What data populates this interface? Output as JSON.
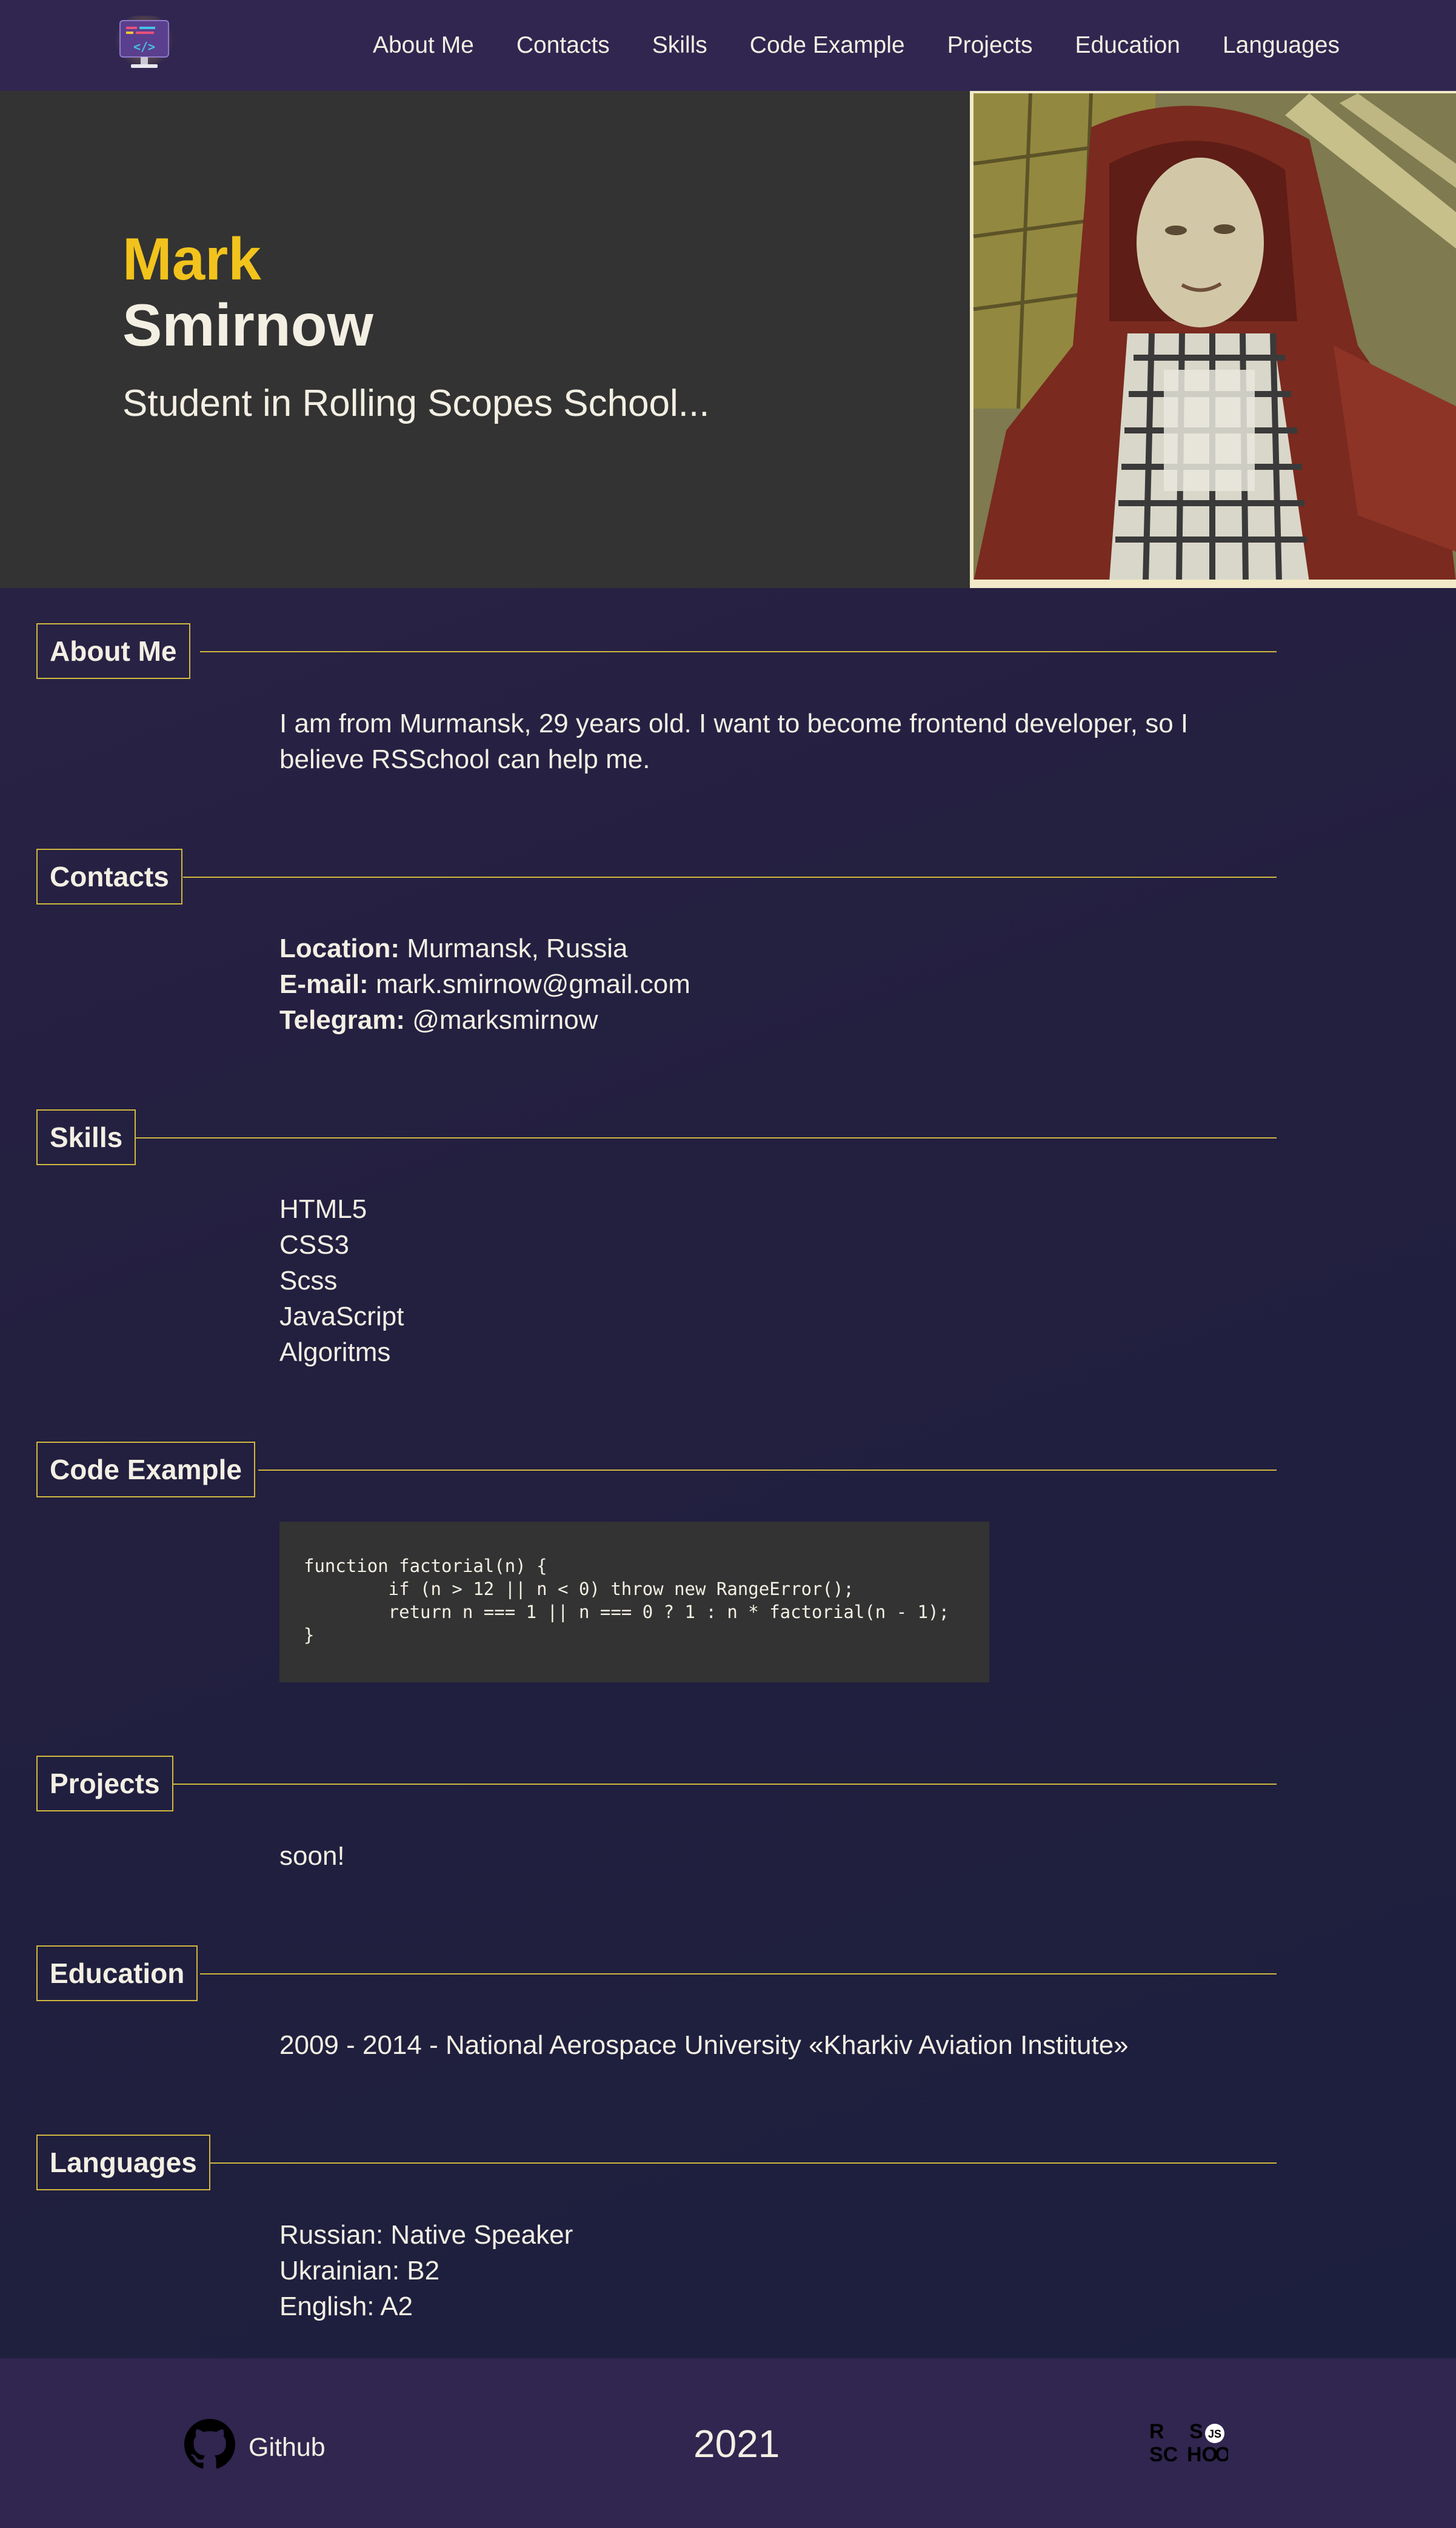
{
  "nav": {
    "logo_icon": "code-monitor-icon",
    "items": [
      "About Me",
      "Contacts",
      "Skills",
      "Code Example",
      "Projects",
      "Education",
      "Languages"
    ]
  },
  "hero": {
    "first_name": "Mark",
    "last_name": "Smirnow",
    "subtitle": "Student in Rolling Scopes School..."
  },
  "about": {
    "title": "About Me",
    "text": "I am from Murmansk, 29 years old. I want to become frontend developer, so I believe RSSchool can help me."
  },
  "contacts": {
    "title": "Contacts",
    "location_label": "Location:",
    "location_value": "Murmansk, Russia",
    "email_label": "E-mail:",
    "email_value": "mark.smirnow@gmail.com",
    "telegram_label": "Telegram:",
    "telegram_value": "@marksmirnow"
  },
  "skills": {
    "title": "Skills",
    "items": [
      "HTML5",
      "CSS3",
      "Scss",
      "JavaScript",
      "Algoritms"
    ]
  },
  "code": {
    "title": "Code Example",
    "snippet": "function factorial(n) {\n        if (n > 12 || n < 0) throw new RangeError();\n        return n === 1 || n === 0 ? 1 : n * factorial(n - 1);\n}"
  },
  "projects": {
    "title": "Projects",
    "text": "soon!"
  },
  "education": {
    "title": "Education",
    "text": "2009 - 2014 - National Aerospace University «Kharkiv Aviation Institute»"
  },
  "languages": {
    "title": "Languages",
    "items": [
      "Russian: Native Speaker",
      "Ukrainian: B2",
      "English: A2"
    ]
  },
  "footer": {
    "github_label": "Github",
    "github_icon": "github-icon",
    "year": "2021",
    "logo_lines": [
      "R S",
      "SC HO OL"
    ],
    "logo_icon": "rs-school-logo"
  },
  "colors": {
    "accent": "#f2c31c",
    "line": "#cfb83e",
    "header_bg": "#302650",
    "hero_bg": "#333333",
    "text": "#f3efe3"
  }
}
